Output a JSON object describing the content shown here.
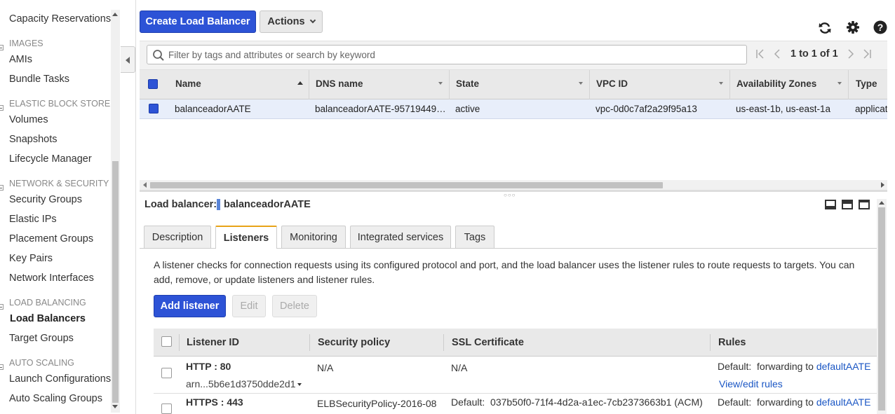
{
  "sidebar": {
    "top_item": "Capacity Reservations",
    "sections": [
      {
        "title": "IMAGES",
        "items": [
          "AMIs",
          "Bundle Tasks"
        ]
      },
      {
        "title": "ELASTIC BLOCK STORE",
        "items": [
          "Volumes",
          "Snapshots",
          "Lifecycle Manager"
        ]
      },
      {
        "title": "NETWORK & SECURITY",
        "items": [
          "Security Groups",
          "Elastic IPs",
          "Placement Groups",
          "Key Pairs",
          "Network Interfaces"
        ]
      },
      {
        "title": "LOAD BALANCING",
        "items": [
          "Load Balancers",
          "Target Groups"
        ]
      },
      {
        "title": "AUTO SCALING",
        "items": [
          "Launch Configurations",
          "Auto Scaling Groups"
        ]
      }
    ],
    "active_item": "Load Balancers"
  },
  "toolbar": {
    "create_label": "Create Load Balancer",
    "actions_label": "Actions",
    "icons": [
      "refresh-icon",
      "gear-icon",
      "help-icon"
    ]
  },
  "search": {
    "placeholder": "Filter by tags and attributes or search by keyword",
    "value": ""
  },
  "pagination": {
    "text": "1 to 1 of 1"
  },
  "lb_table": {
    "columns": [
      "Name",
      "DNS name",
      "State",
      "VPC ID",
      "Availability Zones",
      "Type"
    ],
    "rows": [
      {
        "name": "balanceadorAATE",
        "dns": "balanceadorAATE-95719449…",
        "state": "active",
        "vpc": "vpc-0d0c7af2a29f95a13",
        "azs": "us-east-1b, us-east-1a",
        "type": "application"
      }
    ]
  },
  "detail": {
    "label": "Load balancer:",
    "name": "balanceadorAATE",
    "tabs": [
      "Description",
      "Listeners",
      "Monitoring",
      "Integrated services",
      "Tags"
    ],
    "active_tab": "Listeners",
    "description": "A listener checks for connection requests using its configured protocol and port, and the load balancer uses the listener rules to route requests to targets. You can add, remove, or update listeners and listener rules.",
    "buttons": {
      "add": "Add listener",
      "edit": "Edit",
      "delete": "Delete"
    }
  },
  "listeners": {
    "columns": [
      "Listener ID",
      "Security policy",
      "SSL Certificate",
      "Rules"
    ],
    "rows": [
      {
        "id": "HTTP : 80",
        "arn": "arn...5b6e1d3750dde2d1",
        "policy": "N/A",
        "cert": "N/A",
        "rule_prefix": "Default:  forwarding to",
        "rule_target": "defaultAATE",
        "view_rules": "View/edit rules"
      },
      {
        "id": "HTTPS : 443",
        "policy": "ELBSecurityPolicy-2016-08",
        "cert": "Default:  037b50f0-71f4-4d2a-a1ec-7cb2373663b1 (ACM)",
        "rule_prefix": "Default:  forwarding to",
        "rule_target": "defaultAATE"
      }
    ]
  },
  "colors": {
    "primary": "#2d53d6",
    "selected_row": "#e8eefa",
    "link": "#1a56c4",
    "tab_accent": "#e8a317"
  }
}
